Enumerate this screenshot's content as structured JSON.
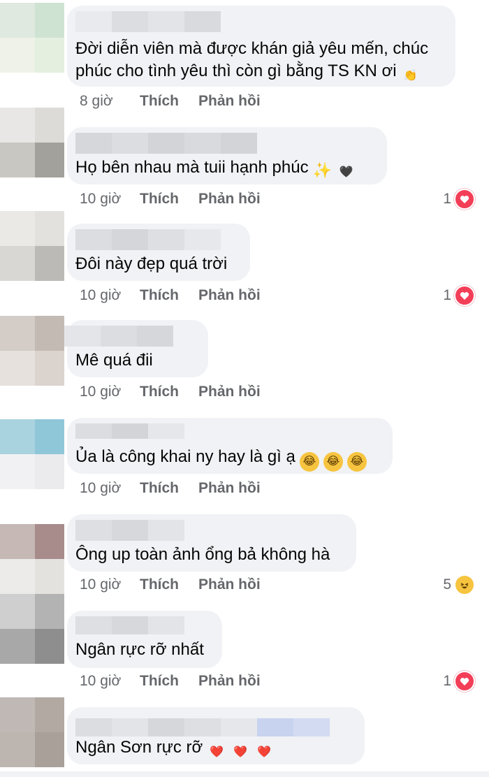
{
  "comments": [
    {
      "text": "Đời diễn viên mà được khán giả yêu mến, chúc\nphúc cho tình yêu thì còn gì bằng TS KN ơi",
      "trailing_emoji": [
        "clapping-hands"
      ],
      "time": "8 giờ",
      "like": "Thích",
      "reply": "Phản hồi",
      "reaction_count": "",
      "reaction_type": ""
    },
    {
      "text": "Họ bên nhau mà tuii hạnh phúc",
      "trailing_emoji": [
        "sparkles",
        "black-heart"
      ],
      "time": "10 giờ",
      "like": "Thích",
      "reply": "Phản hồi",
      "reaction_count": "1",
      "reaction_type": "love"
    },
    {
      "text": "Đôi này đẹp quá trời",
      "trailing_emoji": [],
      "time": "10 giờ",
      "like": "Thích",
      "reply": "Phản hồi",
      "reaction_count": "1",
      "reaction_type": "love"
    },
    {
      "text": "Mê quá đii",
      "trailing_emoji": [],
      "time": "10 giờ",
      "like": "Thích",
      "reply": "Phản hồi",
      "reaction_count": "",
      "reaction_type": ""
    },
    {
      "text": "Ủa là công khai ny hay là gì ạ",
      "trailing_emoji": [
        "rofl",
        "rofl",
        "rofl"
      ],
      "time": "10 giờ",
      "like": "Thích",
      "reply": "Phản hồi",
      "reaction_count": "",
      "reaction_type": ""
    },
    {
      "text": "Ông up toàn ảnh ổng bả không hà",
      "trailing_emoji": [],
      "time": "10 giờ",
      "like": "Thích",
      "reply": "Phản hồi",
      "reaction_count": "5",
      "reaction_type": "haha"
    },
    {
      "text": "Ngân rực rỡ nhất",
      "trailing_emoji": [],
      "time": "10 giờ",
      "like": "Thích",
      "reply": "Phản hồi",
      "reaction_count": "1",
      "reaction_type": "love"
    },
    {
      "text": "Ngân Sơn rực rỡ",
      "trailing_emoji": [
        "red-heart",
        "red-heart",
        "red-heart"
      ],
      "time": "",
      "like": "",
      "reply": "",
      "reaction_count": "",
      "reaction_type": ""
    }
  ],
  "colors": {
    "bubble": "#f0f2f5",
    "meta_text": "#65676b",
    "love": "#f33e58",
    "haha": "#f7c440"
  }
}
